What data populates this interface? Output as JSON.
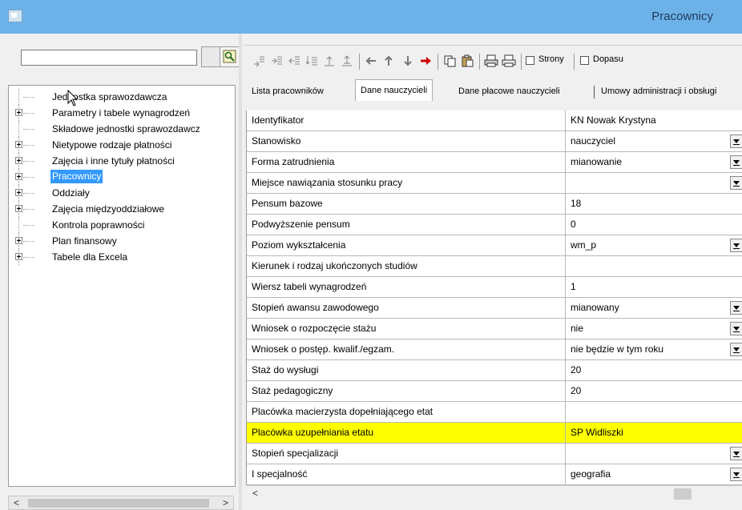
{
  "window": {
    "title": "Pracownicy"
  },
  "search": {
    "value": "",
    "placeholder": ""
  },
  "tree": {
    "items": [
      {
        "label": "Jednostka sprawozdawcza",
        "expandable": false,
        "selected": false
      },
      {
        "label": "Parametry i tabele wynagrodzeń",
        "expandable": true,
        "selected": false
      },
      {
        "label": "Składowe jednostki sprawozdawcz",
        "expandable": false,
        "selected": false
      },
      {
        "label": "Nietypowe rodzaje płatności",
        "expandable": true,
        "selected": false
      },
      {
        "label": "Zajęcia i inne tytuły płatności",
        "expandable": true,
        "selected": false
      },
      {
        "label": "Pracownicy",
        "expandable": true,
        "selected": true
      },
      {
        "label": "Oddziały",
        "expandable": true,
        "selected": false
      },
      {
        "label": "Zajęcia międzyoddziałowe",
        "expandable": true,
        "selected": false
      },
      {
        "label": "Kontrola poprawności",
        "expandable": false,
        "selected": false
      },
      {
        "label": "Plan finansowy",
        "expandable": true,
        "selected": false
      },
      {
        "label": "Tabele dla Excela",
        "expandable": true,
        "selected": false
      }
    ]
  },
  "toolbar": {
    "strony_label": "Strony",
    "dopasuj_label": "Dopasu"
  },
  "tabs": [
    {
      "label": "Lista pracowników",
      "active": false
    },
    {
      "label": "Dane nauczycieli",
      "active": true
    },
    {
      "label": "Dane płacowe nauczycieli",
      "active": false
    },
    {
      "label": "Umowy administracji i obsługi",
      "active": false
    }
  ],
  "grid": {
    "rows": [
      {
        "label": "Identyfikator",
        "value": "KN Nowak Krystyna",
        "dropdown": false,
        "highlight": false
      },
      {
        "label": "Stanowisko",
        "value": "nauczyciel",
        "dropdown": true,
        "highlight": false
      },
      {
        "label": "Forma zatrudnienia",
        "value": "mianowanie",
        "dropdown": true,
        "highlight": false
      },
      {
        "label": "Miejsce nawiązania stosunku pracy",
        "value": "",
        "dropdown": true,
        "highlight": false
      },
      {
        "label": "Pensum bazowe",
        "value": "18",
        "dropdown": false,
        "highlight": false
      },
      {
        "label": "Podwyższenie pensum",
        "value": "0",
        "dropdown": false,
        "highlight": false
      },
      {
        "label": "Poziom wykształcenia",
        "value": "wm_p",
        "dropdown": true,
        "highlight": false
      },
      {
        "label": "Kierunek i rodzaj ukończonych studiów",
        "value": "",
        "dropdown": false,
        "highlight": false
      },
      {
        "label": "Wiersz tabeli wynagrodzeń",
        "value": "1",
        "dropdown": false,
        "highlight": false
      },
      {
        "label": "Stopień awansu zawodowego",
        "value": "mianowany",
        "dropdown": true,
        "highlight": false
      },
      {
        "label": "Wniosek o rozpoczęcie stażu",
        "value": "nie",
        "dropdown": true,
        "highlight": false
      },
      {
        "label": "Wniosek o postęp. kwalif./egzam.",
        "value": "nie będzie w tym roku",
        "dropdown": true,
        "highlight": false
      },
      {
        "label": "Staż do wysługi",
        "value": "20",
        "dropdown": false,
        "highlight": false
      },
      {
        "label": "Staż pedagogiczny",
        "value": "20",
        "dropdown": false,
        "highlight": false
      },
      {
        "label": "Placówka macierzysta dopełniającego etat",
        "value": "",
        "dropdown": false,
        "highlight": false
      },
      {
        "label": "Placówka uzupełniania etatu",
        "value": "SP Widliszki",
        "dropdown": false,
        "highlight": true
      },
      {
        "label": "Stopień specjalizacji",
        "value": "",
        "dropdown": true,
        "highlight": false
      },
      {
        "label": "I specjalność",
        "value": "geografia",
        "dropdown": true,
        "highlight": false
      }
    ]
  },
  "colors": {
    "titlebar": "#6cb2e8",
    "selection": "#3399ff",
    "highlight_row": "#ffff00"
  }
}
